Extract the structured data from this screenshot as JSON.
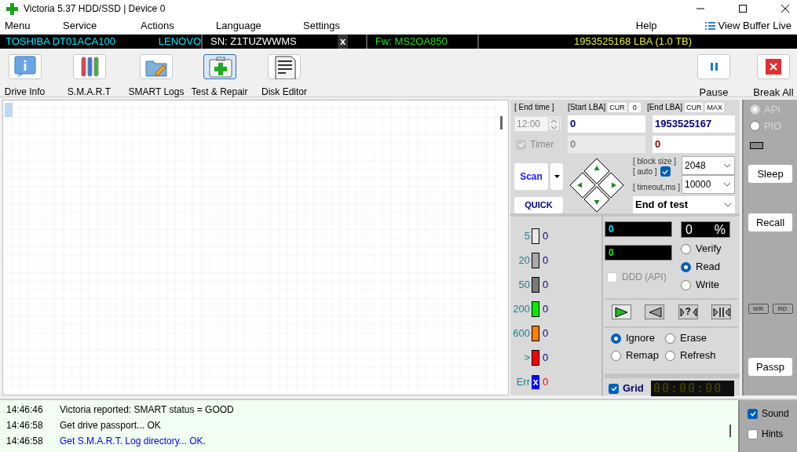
{
  "window": {
    "title": "Victoria 5.37 HDD/SSD | Device 0"
  },
  "menu": {
    "items": [
      "Menu",
      "Service",
      "Actions",
      "Language",
      "Settings"
    ],
    "help": "Help",
    "view_buffer": "View Buffer Live"
  },
  "drive_bar": {
    "model": "TOSHIBA DT01ACA100",
    "vendor": "LENOVO",
    "serial": "SN: Z1TUZWWMS",
    "close": "x",
    "firmware": "Fw: MS2OA850",
    "capacity": "1953525168 LBA (1.0 TB)"
  },
  "toolbar": {
    "tools": [
      {
        "kind": "info",
        "label": "Drive Info",
        "selected": false
      },
      {
        "kind": "smart",
        "label": "S.M.A.R.T",
        "selected": false
      },
      {
        "kind": "logs",
        "label": "SMART Logs",
        "selected": false
      },
      {
        "kind": "repair",
        "label": "Test & Repair",
        "selected": true
      },
      {
        "kind": "editor",
        "label": "Disk Editor",
        "selected": false
      }
    ],
    "actions": [
      {
        "kind": "pause",
        "label": "Pause"
      },
      {
        "kind": "break",
        "label": "Break All"
      }
    ]
  },
  "scan_panel": {
    "end_time_label": "[ End time ]",
    "end_time": "12:00",
    "timer": {
      "label": "Timer",
      "checked": true,
      "disabled": true
    },
    "start_lba_label": "[Start LBA]",
    "start_cur": "CUR",
    "start_cur_value": "0",
    "start_lba": "0",
    "start_lba_current": "0",
    "end_lba_label": "[End LBA]",
    "end_cur": "CUR",
    "end_max": "MAX",
    "end_lba": "1953525167",
    "end_lba_current": "0",
    "scan": "Scan",
    "quick": "QUICK",
    "block_size_label": "[ block size ]",
    "auto_label": "[ auto ]",
    "auto_checked": true,
    "block_size": "2048",
    "timeout_label": "[ timeout,ms ]",
    "timeout": "10000",
    "end_action": "End of test"
  },
  "legend": [
    {
      "label": "5",
      "color": "#e8e8e8",
      "count": "0"
    },
    {
      "label": "20",
      "color": "#a9a9a9",
      "count": "0"
    },
    {
      "label": "50",
      "color": "#7a7a7a",
      "count": "0"
    },
    {
      "label": "200",
      "color": "#00ee00",
      "count": "0"
    },
    {
      "label": "600",
      "color": "#ff8000",
      "count": "0"
    },
    {
      "label": ">",
      "color": "#ff0000",
      "count": "0"
    },
    {
      "label": "Err",
      "color": "#0000ff",
      "count": "0",
      "mark": "x"
    }
  ],
  "counters": {
    "blocks": "0",
    "errors": "0",
    "percent": "0",
    "percent_sign": "%"
  },
  "modes": [
    {
      "label": "Verify",
      "selected": false
    },
    {
      "label": "Read",
      "selected": true
    },
    {
      "label": "Write",
      "selected": false
    }
  ],
  "ddd": {
    "label": "DDD (API)",
    "checked": false,
    "disabled": true
  },
  "transport": [
    {
      "kind": "play",
      "selected": true
    },
    {
      "kind": "back",
      "selected": false
    },
    {
      "kind": "check",
      "text": "?",
      "selected": false
    },
    {
      "kind": "end",
      "selected": false
    }
  ],
  "error_actions": [
    {
      "label": "Ignore",
      "selected": true
    },
    {
      "label": "Erase",
      "selected": false
    },
    {
      "label": "Remap",
      "selected": false
    },
    {
      "label": "Refresh",
      "selected": false
    }
  ],
  "grid": {
    "label": "Grid",
    "checked": true
  },
  "elapsed": "00:00:00",
  "sidebar": {
    "interfaces": [
      {
        "label": "API",
        "selected": true
      },
      {
        "label": "PIO",
        "selected": false
      }
    ],
    "interfaces_disabled": true,
    "buttons": [
      "Sleep",
      "Recall"
    ],
    "indicators": [
      "WR",
      "RD"
    ],
    "passport": "Passp"
  },
  "log": [
    {
      "time": "14:46:46",
      "message": "Victoria reported: SMART status = GOOD",
      "color": "#000000"
    },
    {
      "time": "14:46:58",
      "message": "Get drive passport... OK",
      "color": "#000000"
    },
    {
      "time": "14:46:58",
      "message": "Get S.M.A.R.T. Log directory... OK.",
      "color": "#0000ff"
    }
  ],
  "options": [
    {
      "label": "Sound",
      "checked": true
    },
    {
      "label": "Hints",
      "checked": false
    }
  ]
}
